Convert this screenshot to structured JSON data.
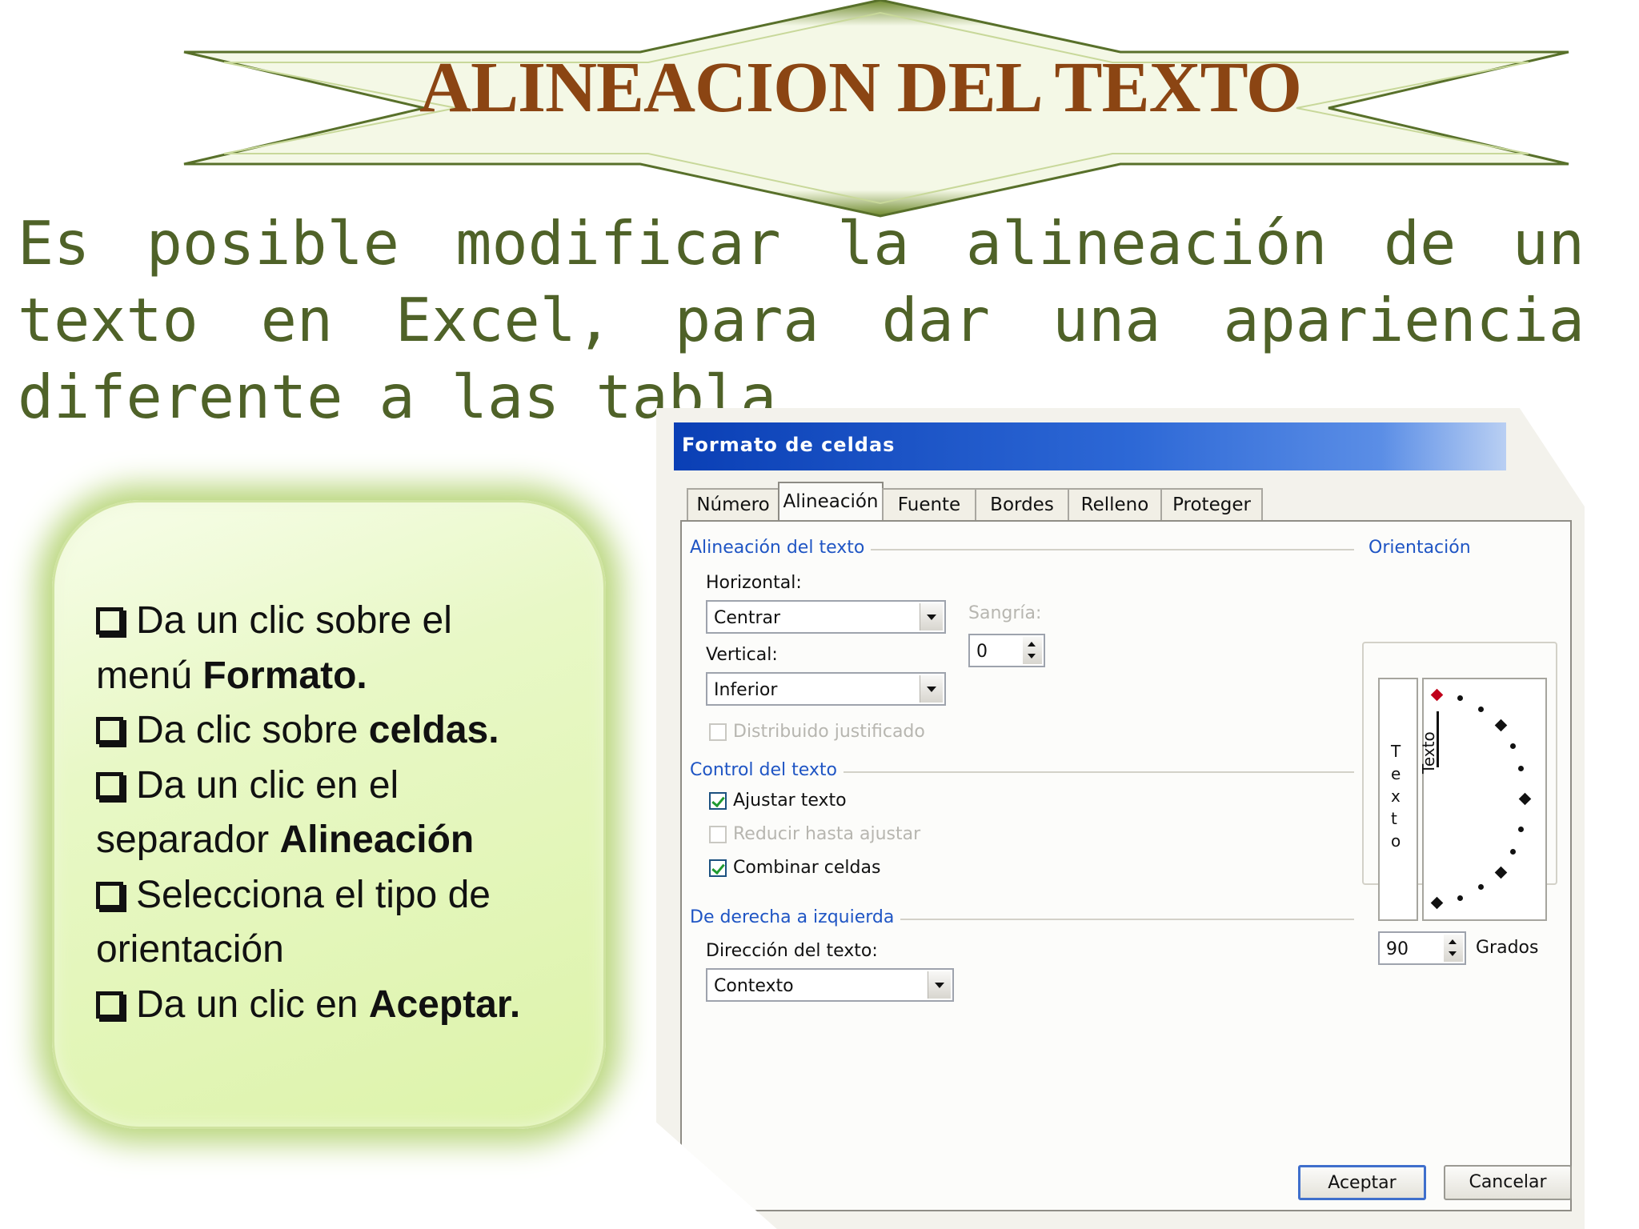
{
  "slide": {
    "title": "ALINEACION DEL TEXTO",
    "intro_lines": [
      "Es posible modificar la alineación de un",
      "texto en Excel, para dar una apariencia",
      "diferente a las tabla."
    ]
  },
  "steps": [
    {
      "text": "Da un clic sobre el",
      "bold": ""
    },
    {
      "text": "menú ",
      "bold": "Formato."
    },
    {
      "text": "Da clic sobre ",
      "bold": "celdas."
    },
    {
      "text": "Da un clic en el",
      "bold": ""
    },
    {
      "text": "separador ",
      "bold": "Alineación"
    },
    {
      "text": "Selecciona el tipo de",
      "bold": ""
    },
    {
      "text": "orientación",
      "bold": ""
    },
    {
      "text": "Da un clic en ",
      "bold": "Aceptar."
    }
  ],
  "dialog": {
    "title": "Formato de celdas",
    "tabs": [
      "Número",
      "Alineación",
      "Fuente",
      "Bordes",
      "Relleno",
      "Proteger"
    ],
    "active_tab": "Alineación",
    "alignment_group": "Alineación del texto",
    "horizontal_label": "Horizontal:",
    "horizontal_value": "Centrar",
    "indent_label": "Sangría:",
    "indent_value": "0",
    "vertical_label": "Vertical:",
    "vertical_value": "Inferior",
    "distributed_label": "Distribuido justificado",
    "text_control_group": "Control del texto",
    "wrap_label": "Ajustar texto",
    "shrink_label": "Reducir hasta ajustar",
    "merge_label": "Combinar celdas",
    "rtl_group": "De derecha a izquierda",
    "direction_label": "Dirección del texto:",
    "direction_value": "Contexto",
    "orientation_group": "Orientación",
    "vertical_text": [
      "T",
      "e",
      "x",
      "t",
      "o"
    ],
    "dial_text": "Texto",
    "degrees_value": "90",
    "degrees_label": "Grados",
    "ok_label": "Aceptar",
    "cancel_label": "Cancelar"
  },
  "colors": {
    "title": "#8B4513",
    "intro": "#4F6228",
    "panel_glow": "#b9d67c",
    "dialog_titlebar": "#0a3fb5"
  }
}
